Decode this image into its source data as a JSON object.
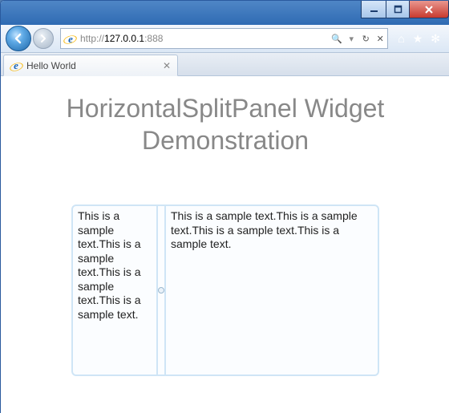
{
  "window": {
    "url_prefix": "http://",
    "url_host": "127.0.0.1",
    "url_suffix": ":888"
  },
  "tab": {
    "title": "Hello World"
  },
  "addr": {
    "search_glyph": "🔍",
    "refresh_glyph": "↻",
    "stop_glyph": "✕"
  },
  "page": {
    "heading": "HorizontalSplitPanel Widget Demonstration",
    "left_text": "This is a sample text.This is a sample text.This is a sample text.This is a sample text.",
    "right_text": "This is a sample text.This is a sample text.This is a sample text.This is a sample text."
  },
  "toolbar": {
    "home_glyph": "⌂",
    "star_glyph": "★",
    "gear_glyph": "✻"
  }
}
